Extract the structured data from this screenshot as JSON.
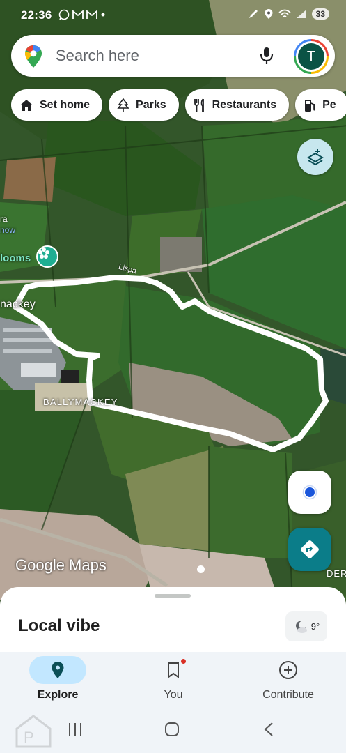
{
  "status_bar": {
    "time": "22:36",
    "left_icons": [
      "whatsapp-icon",
      "gmail-icon",
      "gmail-icon",
      "dot"
    ],
    "right_icons": [
      "pen-icon",
      "location-icon",
      "wifi-icon",
      "signal-icon"
    ],
    "battery": "33"
  },
  "search": {
    "placeholder": "Search here",
    "avatar_letter": "T"
  },
  "chips": [
    {
      "label": "Set home",
      "icon": "home-icon"
    },
    {
      "label": "Parks",
      "icon": "tree-icon"
    },
    {
      "label": "Restaurants",
      "icon": "fork-knife-icon"
    },
    {
      "label": "Pe",
      "icon": "gas-pump-icon"
    }
  ],
  "map": {
    "labels": {
      "ballymackey": "BALLYMACKEY",
      "mackey": "nackey",
      "blooms": "looms",
      "ra": "ra",
      "now": "now",
      "lispa": "Lispa",
      "der": "DER"
    },
    "watermark": "Google Maps",
    "colors": {
      "route": "#ffffff",
      "field": "#3c6b2a",
      "accent": "#0b7d89"
    }
  },
  "sheet": {
    "title": "Local vibe",
    "temperature": "9°"
  },
  "nav": {
    "explore": "Explore",
    "you": "You",
    "contribute": "Contribute"
  }
}
